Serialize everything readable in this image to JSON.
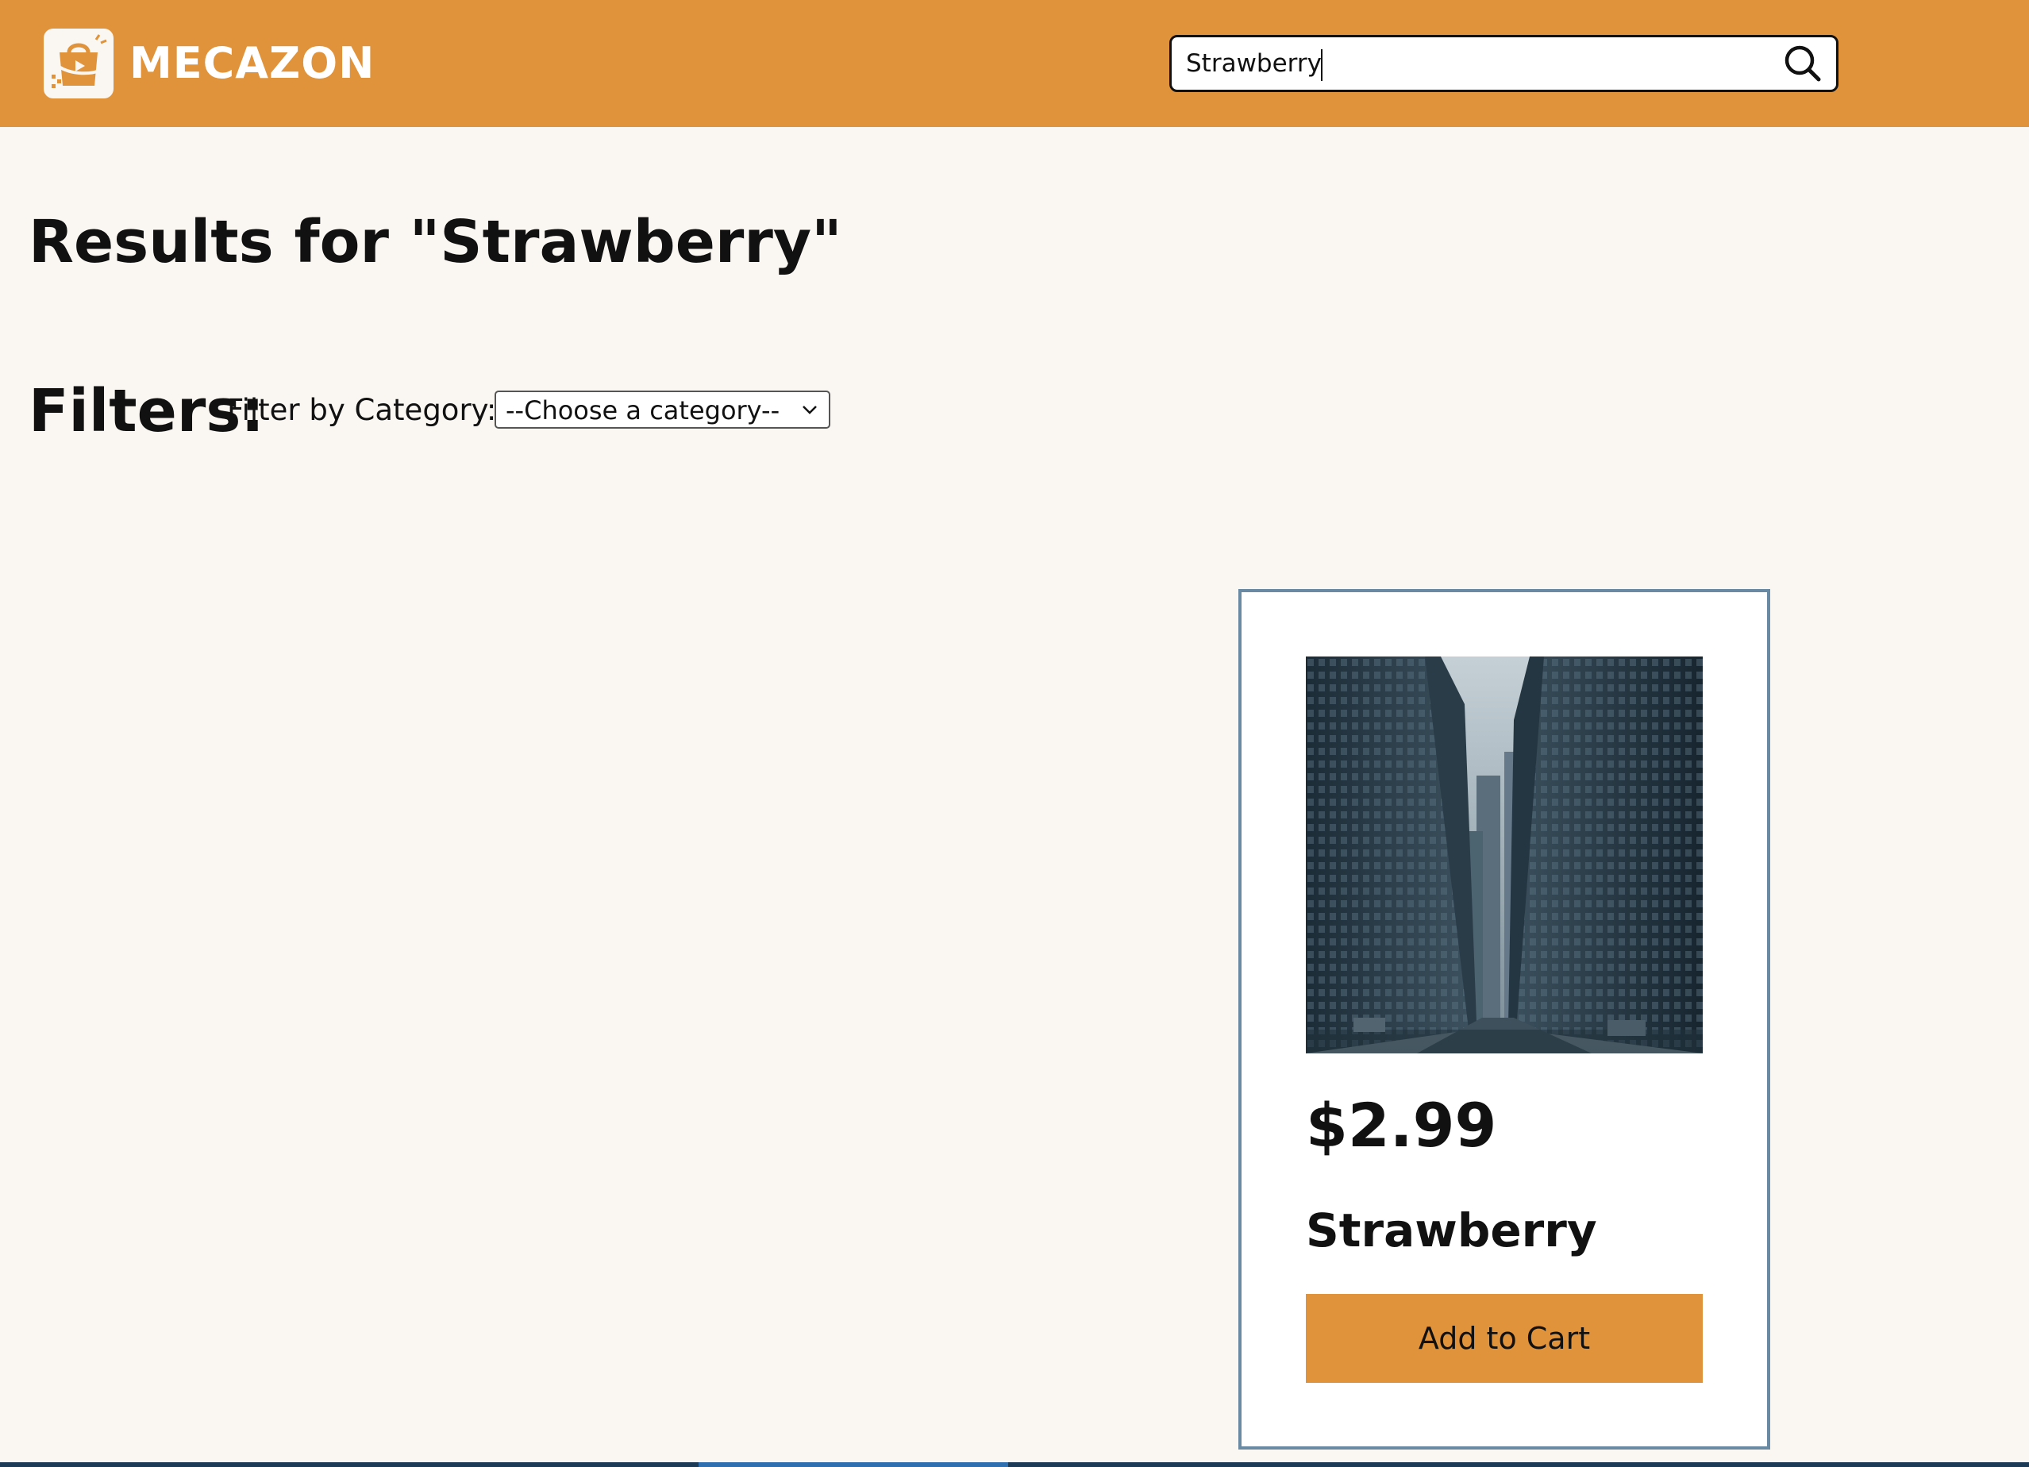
{
  "header": {
    "brand": "MECAZON",
    "search": {
      "value": "Strawberry",
      "icon": "search-icon"
    },
    "logo_icon": "shopping-bag-logo-icon"
  },
  "main": {
    "results_title": "Results for \"Strawberry\"",
    "filters": {
      "heading": "Filters:",
      "category_label": "Filter by Category:",
      "category_selected": "--Choose a category--"
    }
  },
  "products": [
    {
      "price": "$2.99",
      "name": "Strawberry",
      "button_label": "Add to Cart",
      "image": "city-street-photo"
    }
  ],
  "colors": {
    "header_bg": "#e0933a",
    "page_bg": "#faf7f2",
    "card_border": "#6a89a2",
    "button_bg": "#e0933a"
  }
}
